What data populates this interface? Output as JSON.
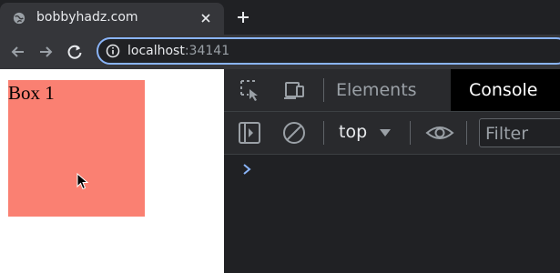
{
  "browser": {
    "tab": {
      "title": "bobbyhadz.com",
      "favicon": "globe-icon",
      "close_icon": "close-icon"
    },
    "new_tab_icon": "plus-icon",
    "toolbar": {
      "back_icon": "arrow-left-icon",
      "forward_icon": "arrow-right-icon",
      "reload_icon": "reload-icon",
      "info_icon": "info-icon",
      "url_host": "localhost",
      "url_port": ":34141"
    }
  },
  "page": {
    "box_label": "Box 1",
    "box_color": "#fa8072"
  },
  "devtools": {
    "tabs": [
      {
        "label": "Elements",
        "active": false
      },
      {
        "label": "Console",
        "active": true
      }
    ],
    "context_selector": "top",
    "filter_placeholder": "Filter",
    "icons": [
      "inspect-element-icon",
      "device-toolbar-icon",
      "sidebar-toggle-icon",
      "clear-console-icon",
      "chevron-down-icon",
      "eye-icon",
      "chevron-right-icon"
    ]
  },
  "colors": {
    "accent": "#8ab4f8",
    "devtools_bg": "#202124"
  }
}
